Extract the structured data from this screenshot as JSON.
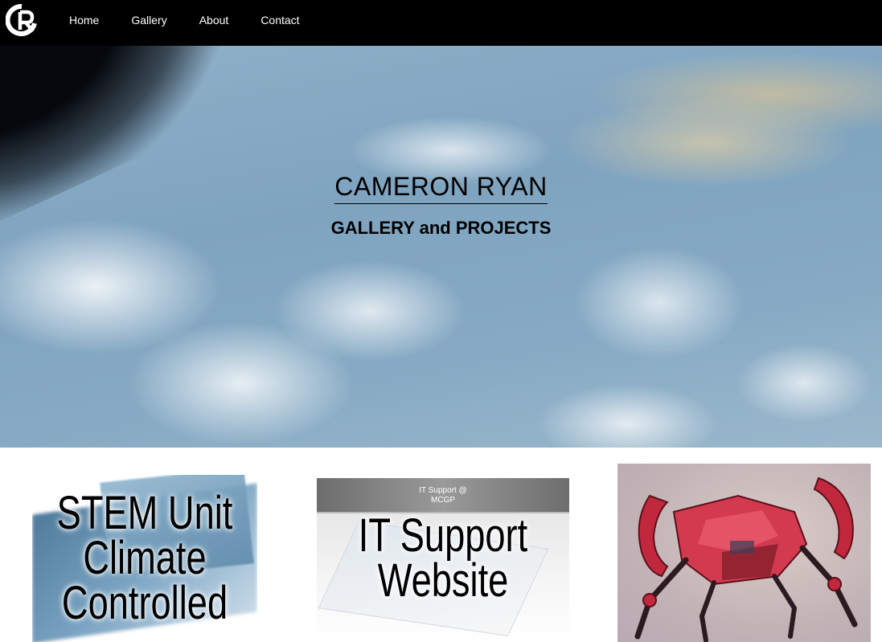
{
  "nav": {
    "logo_icon": "cr-logo-icon",
    "items": [
      {
        "label": "Home"
      },
      {
        "label": "Gallery"
      },
      {
        "label": "About"
      },
      {
        "label": "Contact"
      }
    ]
  },
  "hero": {
    "title": "CAMERON RYAN",
    "subtitle": "GALLERY and PROJECTS"
  },
  "gallery": {
    "cards": [
      {
        "title_lines": [
          "STEM Unit",
          "Climate",
          "Controlled"
        ]
      },
      {
        "title_lines": [
          "IT Support",
          "Website"
        ],
        "screen_header": [
          "IT Support @",
          "MCGP"
        ]
      },
      {
        "image": "red-mech-illustration"
      }
    ]
  },
  "colors": {
    "navbar": "#000000",
    "nav_text": "#ffffff",
    "title_text": "#000000"
  }
}
